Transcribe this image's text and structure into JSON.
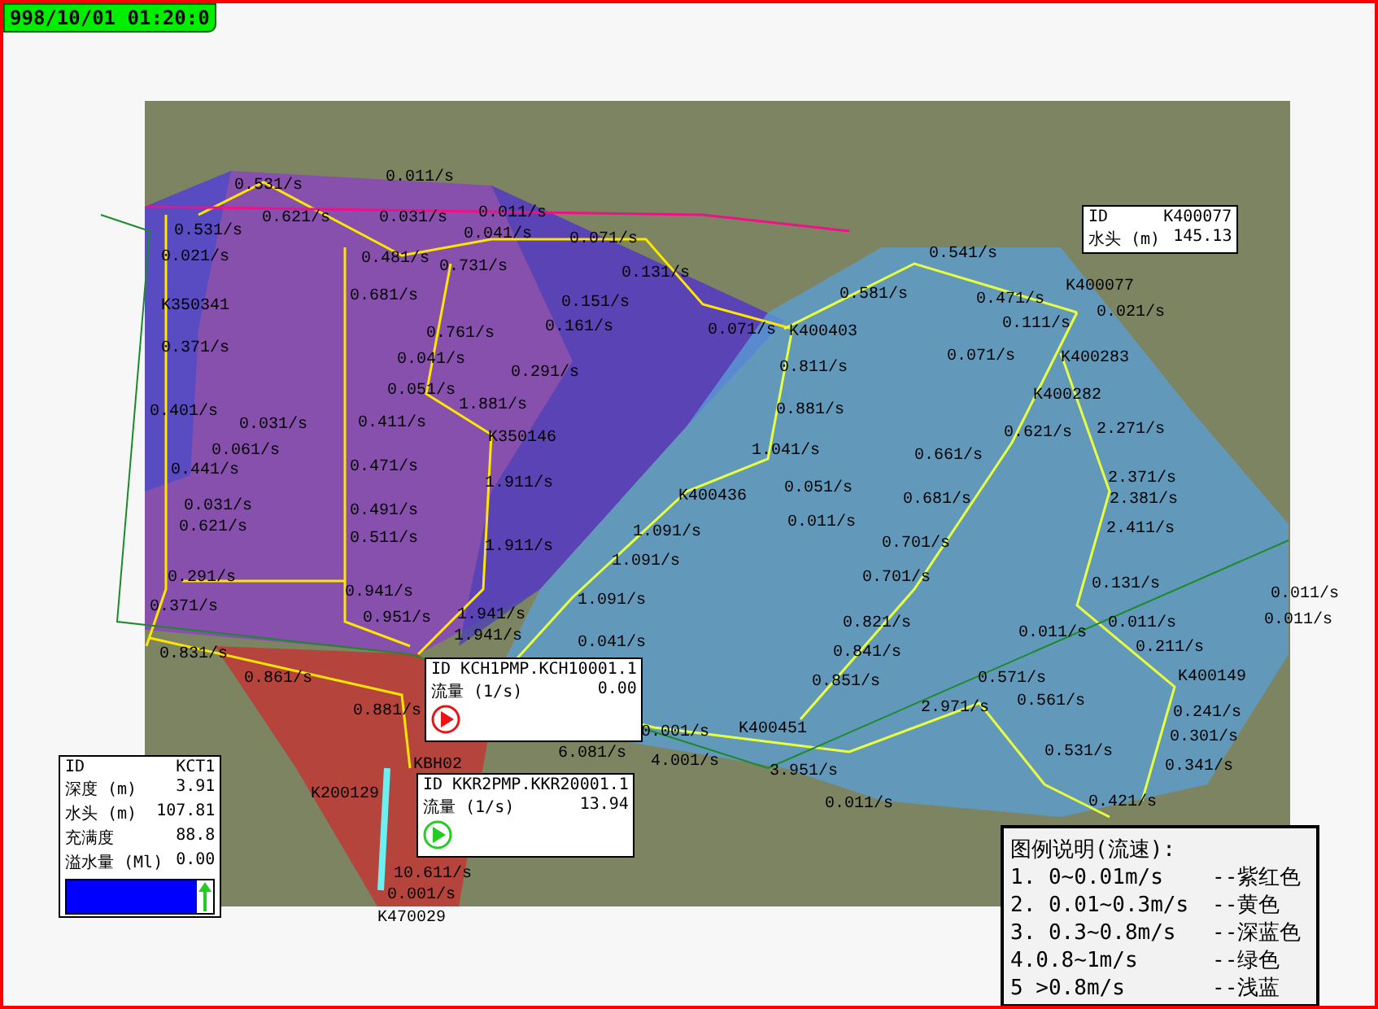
{
  "timestamp": "998/10/01 01:20:0",
  "map": {
    "flow_labels": [
      "0.531/s",
      "0.621/s",
      "0.011/s",
      "0.031/s",
      "0.011/s",
      "0.531/s",
      "0.041/s",
      "0.021/s",
      "0.481/s",
      "0.731/s",
      "0.071/s",
      "0.131/s",
      "0.151/s",
      "0.161/s",
      "0.681/s",
      "0.761/s",
      "0.041/s",
      "0.051/s",
      "0.291/s",
      "1.881/s",
      "0.371/s",
      "0.401/s",
      "0.031/s",
      "0.411/s",
      "0.061/s",
      "0.441/s",
      "0.471/s",
      "0.031/s",
      "0.621/s",
      "0.491/s",
      "0.511/s",
      "1.911/s",
      "1.911/s",
      "0.291/s",
      "0.941/s",
      "0.371/s",
      "0.951/s",
      "1.941/s",
      "1.941/s",
      "0.831/s",
      "0.861/s",
      "0.881/s",
      "0.071/s",
      "0.581/s",
      "0.811/s",
      "0.881/s",
      "1.041/s",
      "0.051/s",
      "0.011/s",
      "1.091/s",
      "1.091/s",
      "1.091/s",
      "0.041/s",
      "0.001/s",
      "6.081/s",
      "4.001/s",
      "3.951/s",
      "0.011/s",
      "0.701/s",
      "0.821/s",
      "0.841/s",
      "0.851/s",
      "0.661/s",
      "0.681/s",
      "0.701/s",
      "0.621/s",
      "0.541/s",
      "0.471/s",
      "0.111/s",
      "0.021/s",
      "0.071/s",
      "2.271/s",
      "2.371/s",
      "2.381/s",
      "2.411/s",
      "0.131/s",
      "0.011/s",
      "0.011/s",
      "0.011/s",
      "0.011/s",
      "0.211/s",
      "0.571/s",
      "0.561/s",
      "2.971/s",
      "0.531/s",
      "0.241/s",
      "0.301/s",
      "0.341/s",
      "0.421/s",
      "10.611/s",
      "0.001/s"
    ],
    "node_labels": [
      "K350341",
      "K350146",
      "K400403",
      "K400436",
      "K400077",
      "K400283",
      "K400282",
      "K400451",
      "K400149",
      "K200129",
      "K470029",
      "KBH02"
    ]
  },
  "info_boxes": [
    {
      "kind": "node",
      "rows": [
        {
          "label": "ID",
          "value": "K400077"
        },
        {
          "label": "水头 (m)",
          "value": "145.13"
        }
      ]
    },
    {
      "kind": "pump",
      "id": "ID KCH1PMP.KCH10001.1",
      "rows": [
        {
          "label": "流量 (1/s)",
          "value": "0.00"
        }
      ],
      "on": false
    },
    {
      "kind": "pump",
      "id": "ID KKR2PMP.KKR20001.1",
      "rows": [
        {
          "label": "流量 (1/s)",
          "value": "13.94"
        }
      ],
      "on": true
    }
  ],
  "tank": {
    "rows": [
      {
        "label": "ID",
        "value": "KCT1"
      },
      {
        "label": "深度 (m)",
        "value": "3.91"
      },
      {
        "label": "水头 (m)",
        "value": "107.81"
      },
      {
        "label": "充满度",
        "value": "88.8"
      },
      {
        "label": "溢水量 (Ml)",
        "value": "0.00"
      }
    ],
    "level": 0.89
  },
  "legend": {
    "title": "图例说明(流速):",
    "rows": [
      {
        "range": "1.  0~0.01m/s",
        "color_name": "--紫红色"
      },
      {
        "range": "2.  0.01~0.3m/s",
        "color_name": "--黄色"
      },
      {
        "range": "3.  0.3~0.8m/s",
        "color_name": "--深蓝色"
      },
      {
        "range": "4.0.8~1m/s",
        "color_name": "--绿色"
      },
      {
        "range": "5 >0.8m/s",
        "color_name": "--浅蓝"
      }
    ]
  }
}
